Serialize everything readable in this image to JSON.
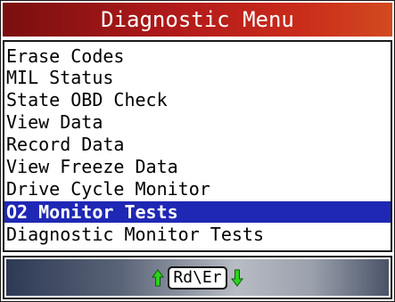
{
  "title": "Diagnostic Menu",
  "menu": {
    "items": [
      {
        "label": "Erase Codes"
      },
      {
        "label": "MIL Status"
      },
      {
        "label": "State OBD Check"
      },
      {
        "label": "View Data"
      },
      {
        "label": "Record Data"
      },
      {
        "label": "View Freeze Data"
      },
      {
        "label": "Drive Cycle Monitor"
      },
      {
        "label": "O2 Monitor Tests"
      },
      {
        "label": "Diagnostic Monitor Tests"
      }
    ],
    "selected_label": "O2 Monitor Tests"
  },
  "nav": {
    "up_icon": "green-up-arrow-icon",
    "key_label": "Rd\\Er",
    "down_icon": "green-down-arrow-icon"
  },
  "colors": {
    "title_bg": "#b21a1a",
    "highlight": "#1f28b4",
    "arrow_green": "#2dd11e"
  }
}
